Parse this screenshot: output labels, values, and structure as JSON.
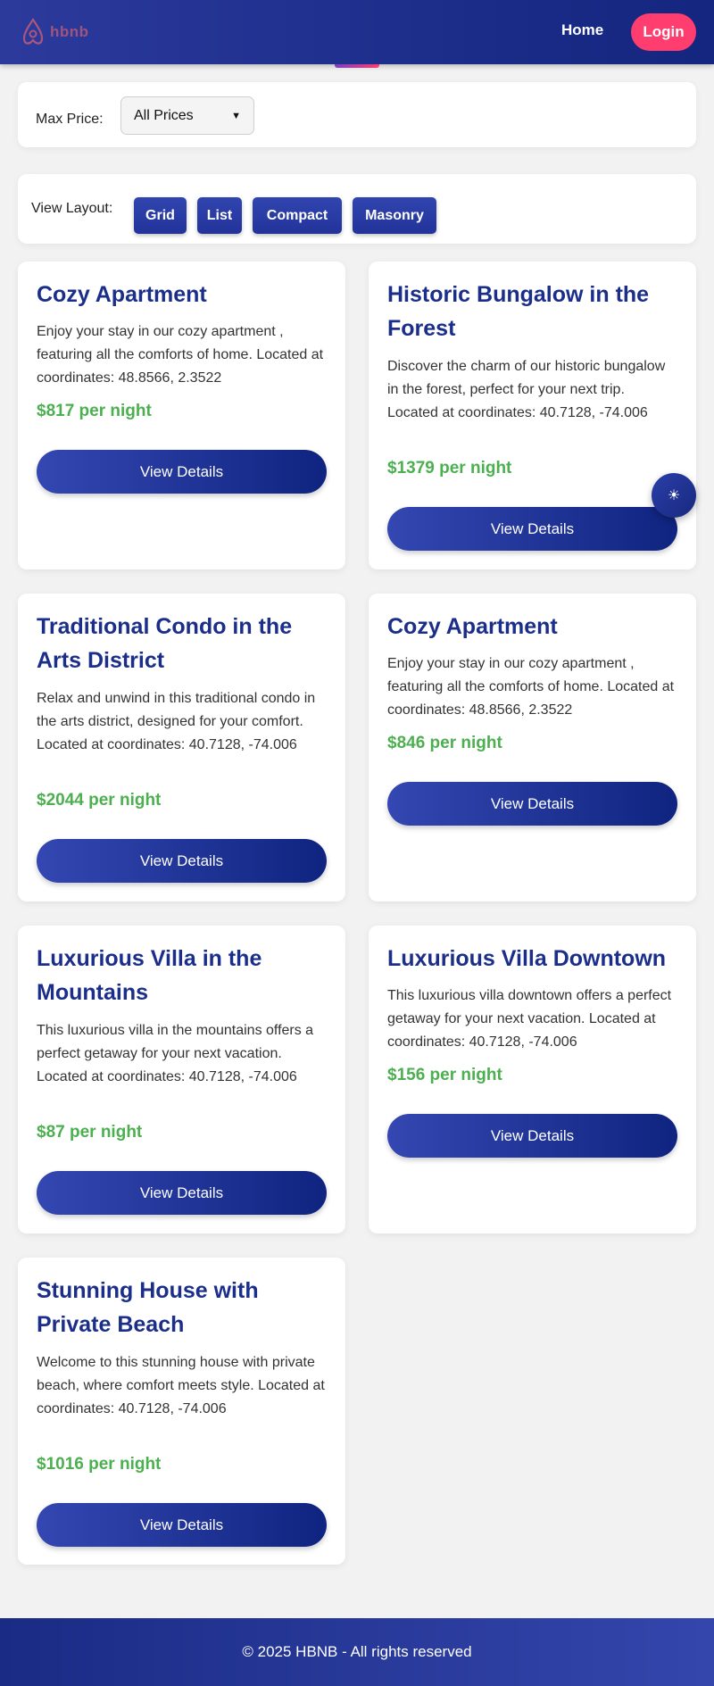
{
  "header": {
    "logo_text": "hbnb",
    "nav": {
      "home": "Home",
      "login": "Login"
    }
  },
  "filter": {
    "label": "Max Price:",
    "selected": "All Prices"
  },
  "layout": {
    "label": "View Layout:",
    "buttons": [
      "Grid",
      "List",
      "Compact",
      "Masonry"
    ]
  },
  "places": [
    {
      "title": "Cozy Apartment",
      "description": "Enjoy your stay in our cozy apartment , featuring all the comforts of home. Located at coordinates: 48.8566, 2.3522",
      "price": "$817 per night",
      "button": "View Details"
    },
    {
      "title": "Historic Bungalow in the Forest",
      "description": "Discover the charm of our historic bungalow in the forest, perfect for your next trip. Located at coordinates: 40.7128, -74.006",
      "price": "$1379 per night",
      "button": "View Details"
    },
    {
      "title": "Traditional Condo in the Arts District",
      "description": "Relax and unwind in this traditional condo in the arts district, designed for your comfort. Located at coordinates: 40.7128, -74.006",
      "price": "$2044 per night",
      "button": "View Details"
    },
    {
      "title": "Cozy Apartment",
      "description": "Enjoy your stay in our cozy apartment , featuring all the comforts of home. Located at coordinates: 48.8566, 2.3522",
      "price": "$846 per night",
      "button": "View Details"
    },
    {
      "title": "Luxurious Villa in the Mountains",
      "description": "This luxurious villa in the mountains offers a perfect getaway for your next vacation. Located at coordinates: 40.7128, -74.006",
      "price": "$87 per night",
      "button": "View Details"
    },
    {
      "title": "Luxurious Villa Downtown",
      "description": "This luxurious villa downtown offers a perfect getaway for your next vacation. Located at coordinates: 40.7128, -74.006",
      "price": "$156 per night",
      "button": "View Details"
    },
    {
      "title": "Stunning House with Private Beach",
      "description": "Welcome to this stunning house with private beach, where comfort meets style. Located at coordinates: 40.7128, -74.006",
      "price": "$1016 per night",
      "button": "View Details"
    }
  ],
  "theme_toggle": {
    "icon": "sun-icon",
    "glyph": "☀"
  },
  "footer": {
    "text": "© 2025 HBNB - All rights reserved"
  },
  "colors": {
    "primary": "#1a2e8a",
    "accent": "#ff3d6e",
    "price": "#4caf50",
    "background": "#f2f2f2"
  }
}
